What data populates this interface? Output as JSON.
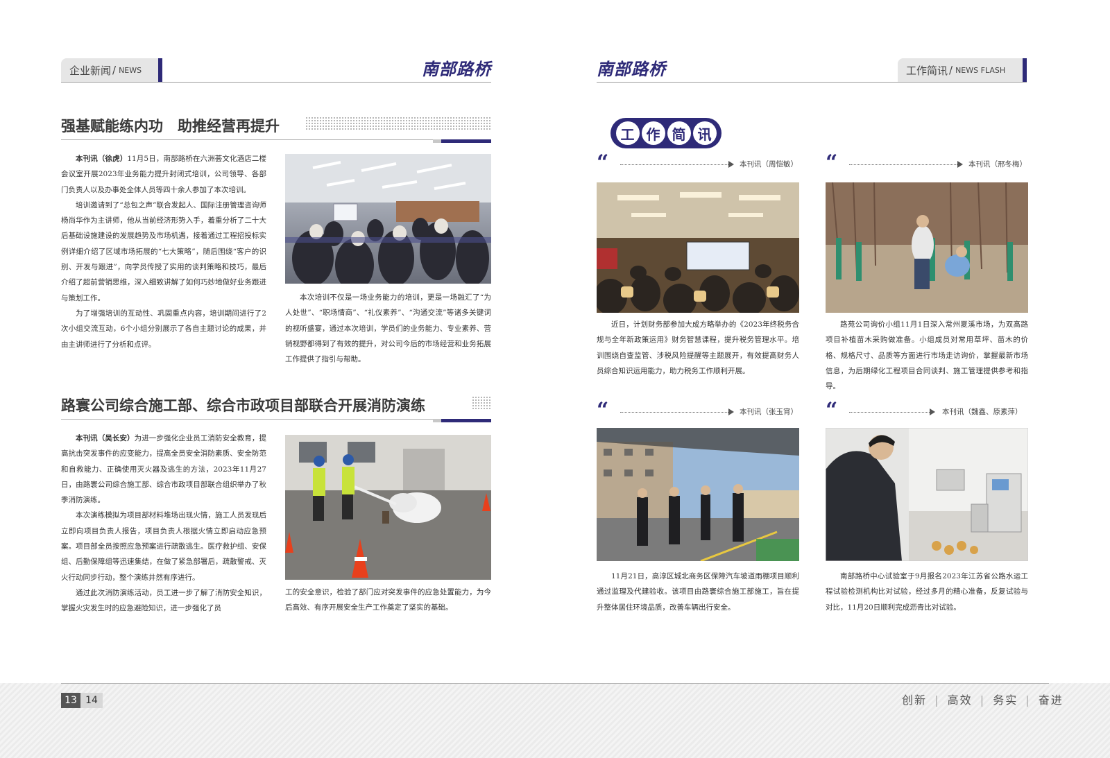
{
  "left_page": {
    "tab": {
      "cn": "企业新闻",
      "slash": "/",
      "en": "NEWS"
    },
    "brand": "南部路桥",
    "article1": {
      "title": "强基赋能练内功　助推经营再提升",
      "col1": [
        {
          "lead": "本刊讯（徐虎）",
          "text": "11月5日，南部路桥在六洲荟文化酒店二楼会议室开展2023年业务能力提升封闭式培训，公司领导、各部门负责人以及办事处全体人员等四十余人参加了本次培训。"
        },
        {
          "lead": "",
          "text": "培训邀请到了“总包之声”联合发起人、国际注册管理咨询师杨尚华作为主讲师，他从当前经济形势入手，着重分析了二十大后基础设施建设的发展趋势及市场机遇，接着通过工程招投标实例详细介绍了区域市场拓展的“七大策略”，随后围绕“客户的识别、开发与跟进”，向学员传授了实用的谈判策略和技巧，最后介绍了超前营销思维，深入细致讲解了如何巧妙地做好业务跟进与策划工作。"
        },
        {
          "lead": "",
          "text": "为了增强培训的互动性、巩固重点内容，培训期间进行了2次小组交流互动，6个小组分别展示了各自主题讨论的成果，并由主讲师进行了分析和点评。"
        }
      ],
      "col2": "本次培训不仅是一场业务能力的培训，更是一场融汇了“为人处世”、“职场情商”、“礼仪素养”、“沟通交流”等诸多关键词的视听盛宴，通过本次培训，学员们的业务能力、专业素养、营销视野都得到了有效的提升，对公司今后的市场经营和业务拓展工作提供了指引与帮助。"
    },
    "article2": {
      "title": "路寰公司综合施工部、综合市政项目部联合开展消防演练",
      "col1": [
        {
          "lead": "本刊讯（吴长安）",
          "text": "为进一步强化企业员工消防安全教育，提高抗击突发事件的应变能力，提高全员安全消防素质、安全防范和自救能力、正确使用灭火器及逃生的方法，2023年11月27日，由路寰公司综合施工部、综合市政项目部联合组织举办了秋季消防演练。"
        },
        {
          "lead": "",
          "text": "本次演练模拟为项目部材料堆场出现火情，施工人员发现后立即向项目负责人报告，项目负责人根据火情立即启动应急预案。项目部全员按照应急预案进行疏散逃生。医疗救护组、安保组、后勤保障组等迅速集结，在做了紧急部署后，疏散警戒、灭火行动同步行动，整个演练井然有序进行。"
        },
        {
          "lead": "",
          "text": "通过此次消防演练活动，员工进一步了解了消防安全知识，掌握火灾发生时的应急避险知识，进一步强化了员"
        }
      ],
      "col2": "工的安全意识，检验了部门应对突发事件的应急处置能力，为今后高效、有序开展安全生产工作奠定了坚实的基础。"
    }
  },
  "right_page": {
    "brand": "南部路桥",
    "tab": {
      "cn": "工作简讯",
      "slash": "/",
      "en": "NEWS FLASH"
    },
    "badge_chars": [
      "工",
      "作",
      "简",
      "讯"
    ],
    "items": [
      {
        "byline": "本刊讯（周恺敏）",
        "text": "近日，计划财务部参加大成方略举办的《2023年终税务合规与全年新政策运用》财务智慧课程，提升税务管理水平。培训围绕自查监管、涉税风险提醒等主题展开，有效提高财务人员综合知识运用能力，助力税务工作顺利开展。"
      },
      {
        "byline": "本刊讯（邢冬梅）",
        "text": "路苑公司询价小组11月1日深入常州夏溪市场，为双高路项目补植苗木采购做准备。小组成员对常用草坪、苗木的价格、规格尺寸、品质等方面进行市场走访询价，掌握最新市场信息，为后期绿化工程项目合同谈判、施工管理提供参考和指导。"
      },
      {
        "byline": "本刊讯（张玉宵）",
        "text": "11月21日，高淳区城北商务区保障汽车坡道雨棚项目顺利通过监理及代建验收。该项目由路寰综合施工部施工，旨在提升整体居住环境品质，改善车辆出行安全。"
      },
      {
        "byline": "本刊讯（魏鑫、原素萍）",
        "text": "南部路桥中心试验室于9月报名2023年江苏省公路水运工程试验检测机构比对试验，经过多月的精心准备，反复试验与对比，11月20日顺利完成沥青比对试验。"
      }
    ]
  },
  "footer": {
    "page_left": "13",
    "page_right": "14",
    "slogan": [
      "创新",
      "高效",
      "务实",
      "奋进"
    ]
  },
  "colors": {
    "accent": "#2e2a78",
    "tab_bg": "#e6e6e6"
  },
  "icons": [
    "quote-mark-icon",
    "arrow-right-icon"
  ]
}
